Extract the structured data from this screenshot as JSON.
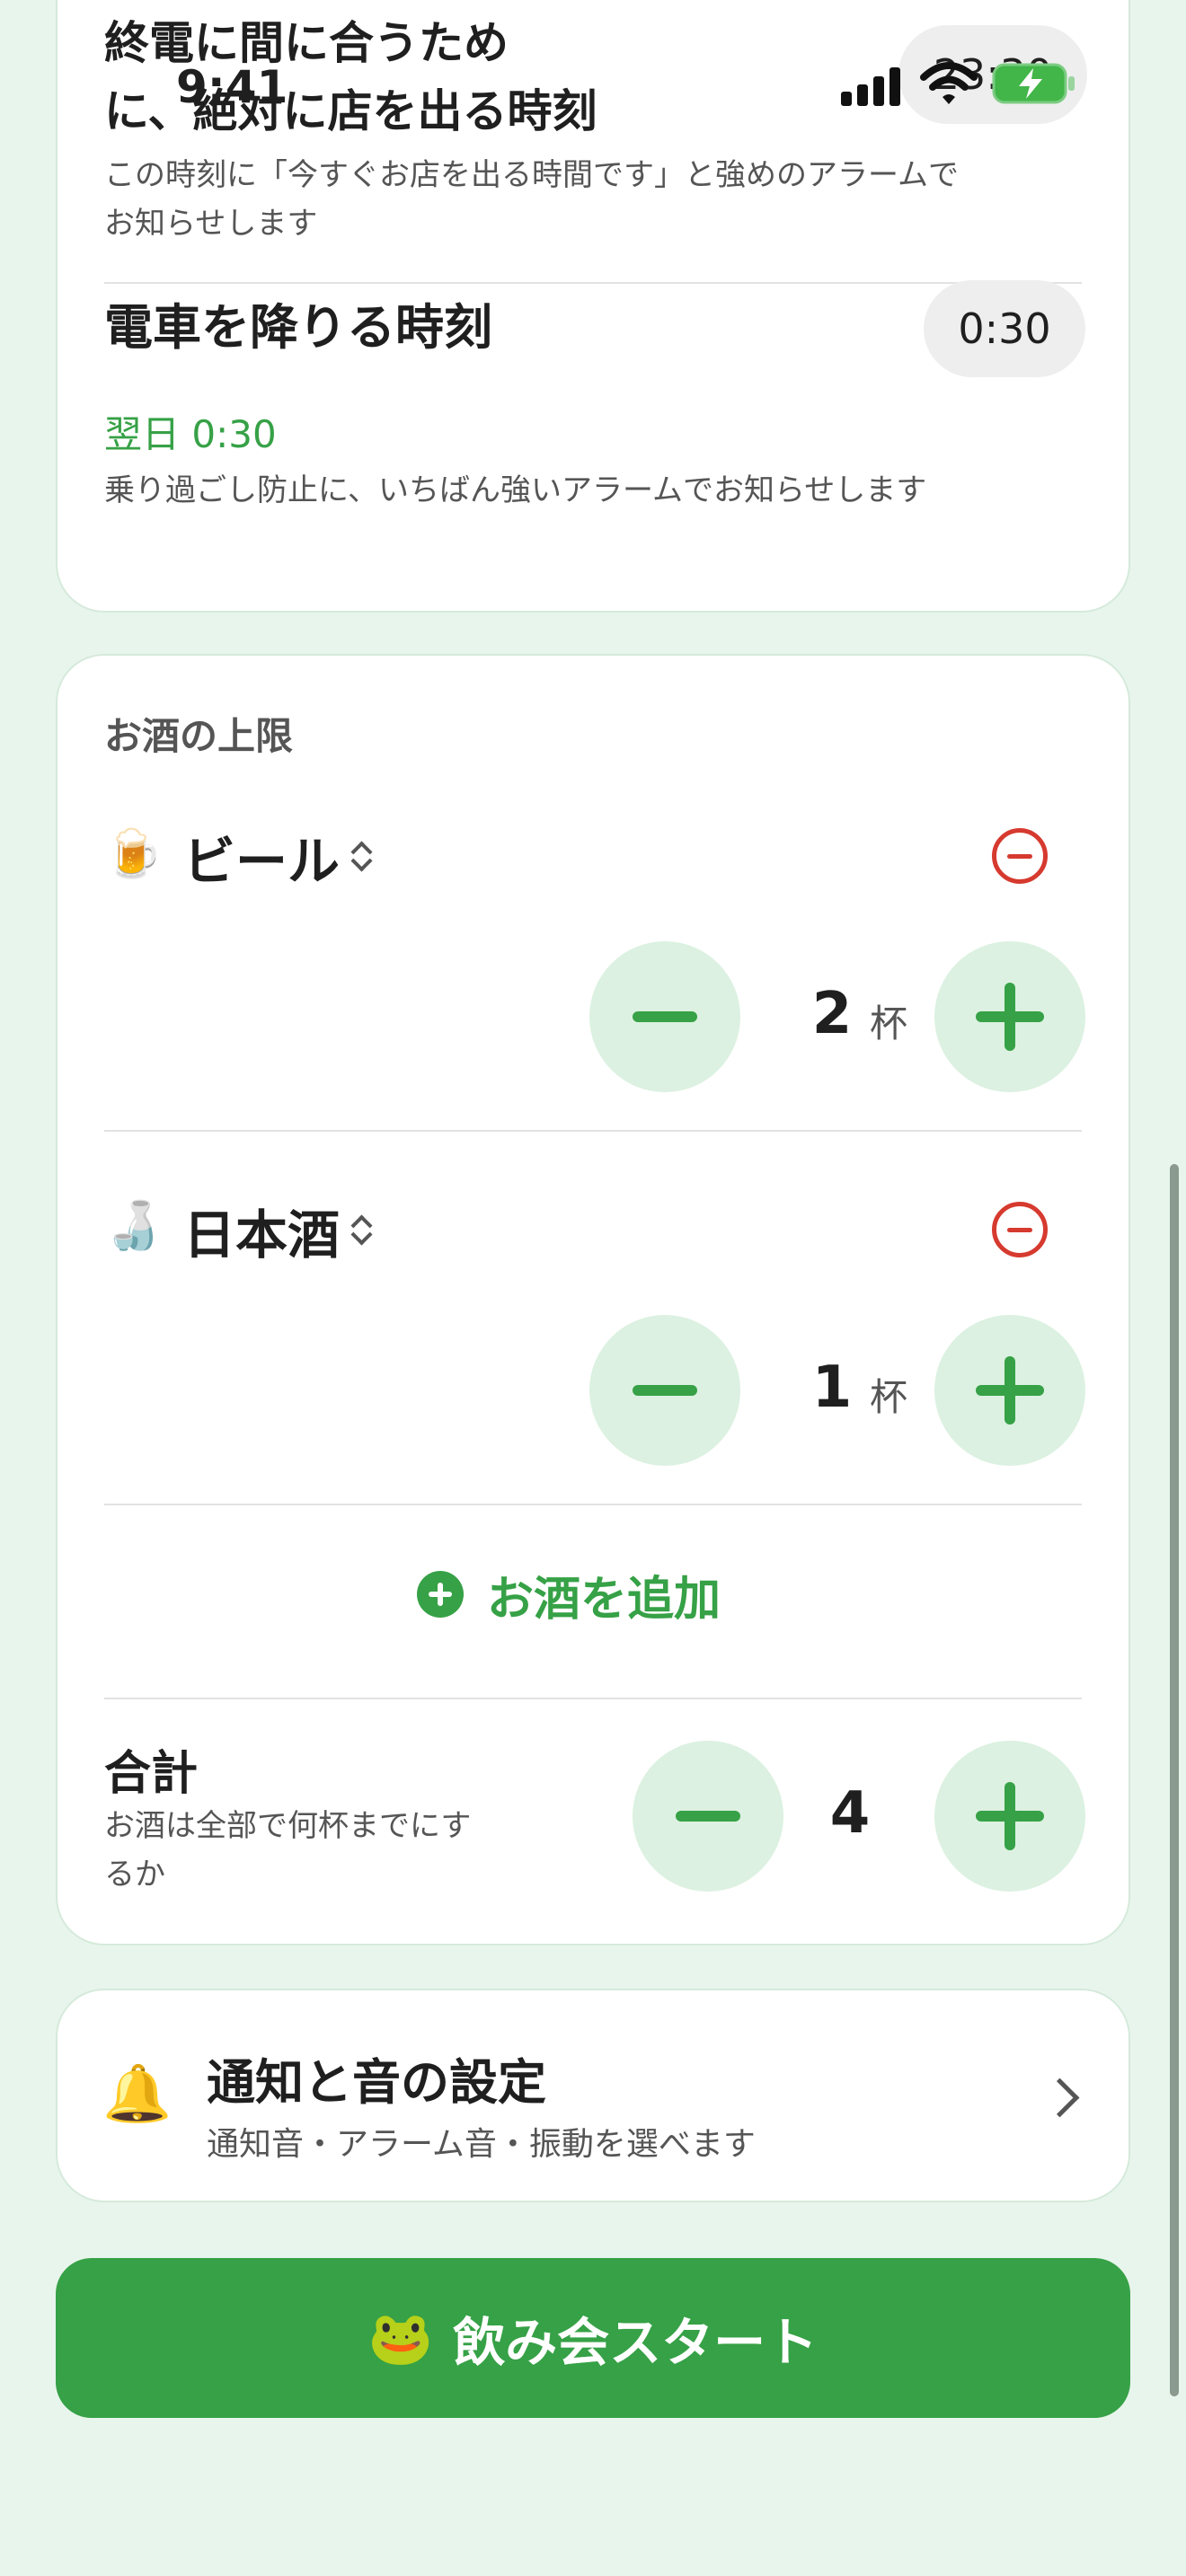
{
  "status_bar": {
    "time": "9:41"
  },
  "alarms": {
    "leave_title": "終電に間に合うため\nに、絶対に店を出る時刻",
    "leave_time": "23:30",
    "leave_desc": "この時刻に「今すぐお店を出る時間です」と強めのアラームで\nお知らせします",
    "getoff_title": "電車を降りる時刻",
    "getoff_time": "0:30",
    "getoff_next_day": "翌日 0:30",
    "getoff_desc": "乗り過ごし防止に、いちばん強いアラームでお知らせします"
  },
  "drinks": {
    "section_title": "お酒の上限",
    "items": [
      {
        "emoji": "🍺",
        "name": "ビール",
        "count": "2",
        "unit": "杯"
      },
      {
        "emoji": "🍶",
        "name": "日本酒",
        "count": "1",
        "unit": "杯"
      }
    ],
    "add_label": "お酒を追加",
    "total_title": "合計",
    "total_desc": "お酒は全部で何杯までにす\nるか",
    "total_count": "4"
  },
  "settings": {
    "emoji": "🔔",
    "title": "通知と音の設定",
    "subtitle": "通知音・アラーム音・振動を選べます"
  },
  "start_button": {
    "emoji": "🐸",
    "label": "飲み会スタート"
  },
  "colors": {
    "accent": "#36A146",
    "danger": "#D63A2F",
    "background": "#E8F5EC",
    "button_tint": "#DCF1E1"
  },
  "icons": [
    "signal-icon",
    "wifi-icon",
    "battery-charging-icon",
    "chevron-updown-icon",
    "minus-circle-icon",
    "plus-circle-icon",
    "chevron-right-icon"
  ]
}
